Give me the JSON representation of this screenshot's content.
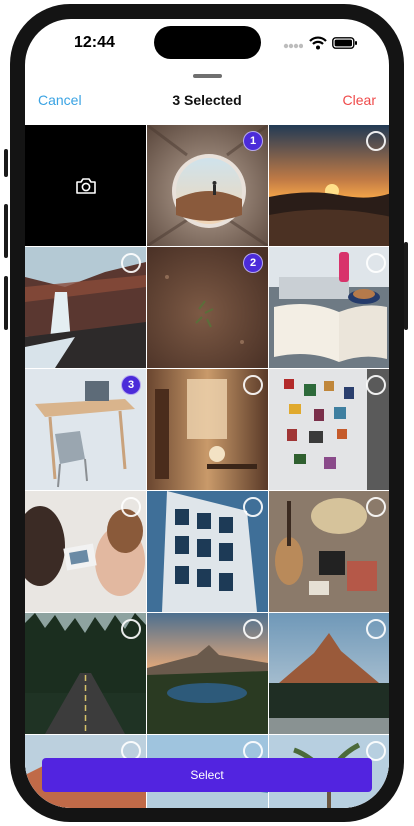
{
  "status_bar": {
    "time": "12:44"
  },
  "sheet": {
    "cancel_label": "Cancel",
    "title": "3 Selected",
    "clear_label": "Clear"
  },
  "camera_icon": "camera-icon",
  "photos": [
    {
      "name": "tent-photo",
      "selected": 1
    },
    {
      "name": "sunset-photo",
      "selected": null
    },
    {
      "name": "waterfall-photo",
      "selected": null
    },
    {
      "name": "ground-photo",
      "selected": 2
    },
    {
      "name": "book-coffee-photo",
      "selected": null
    },
    {
      "name": "laptop-desk-photo",
      "selected": 3
    },
    {
      "name": "cafe-photo",
      "selected": null
    },
    {
      "name": "fridge-photos-photo",
      "selected": null
    },
    {
      "name": "kids-photos-photo",
      "selected": null
    },
    {
      "name": "building-photo",
      "selected": null
    },
    {
      "name": "guitar-table-photo",
      "selected": null
    },
    {
      "name": "forest-road-photo",
      "selected": null
    },
    {
      "name": "lake-mountain-photo",
      "selected": null
    },
    {
      "name": "peak-forest-photo",
      "selected": null
    },
    {
      "name": "canyon-photo",
      "selected": null
    },
    {
      "name": "coast-photo",
      "selected": null
    },
    {
      "name": "palm-photo",
      "selected": null
    }
  ],
  "select_button": {
    "label": "Select"
  }
}
